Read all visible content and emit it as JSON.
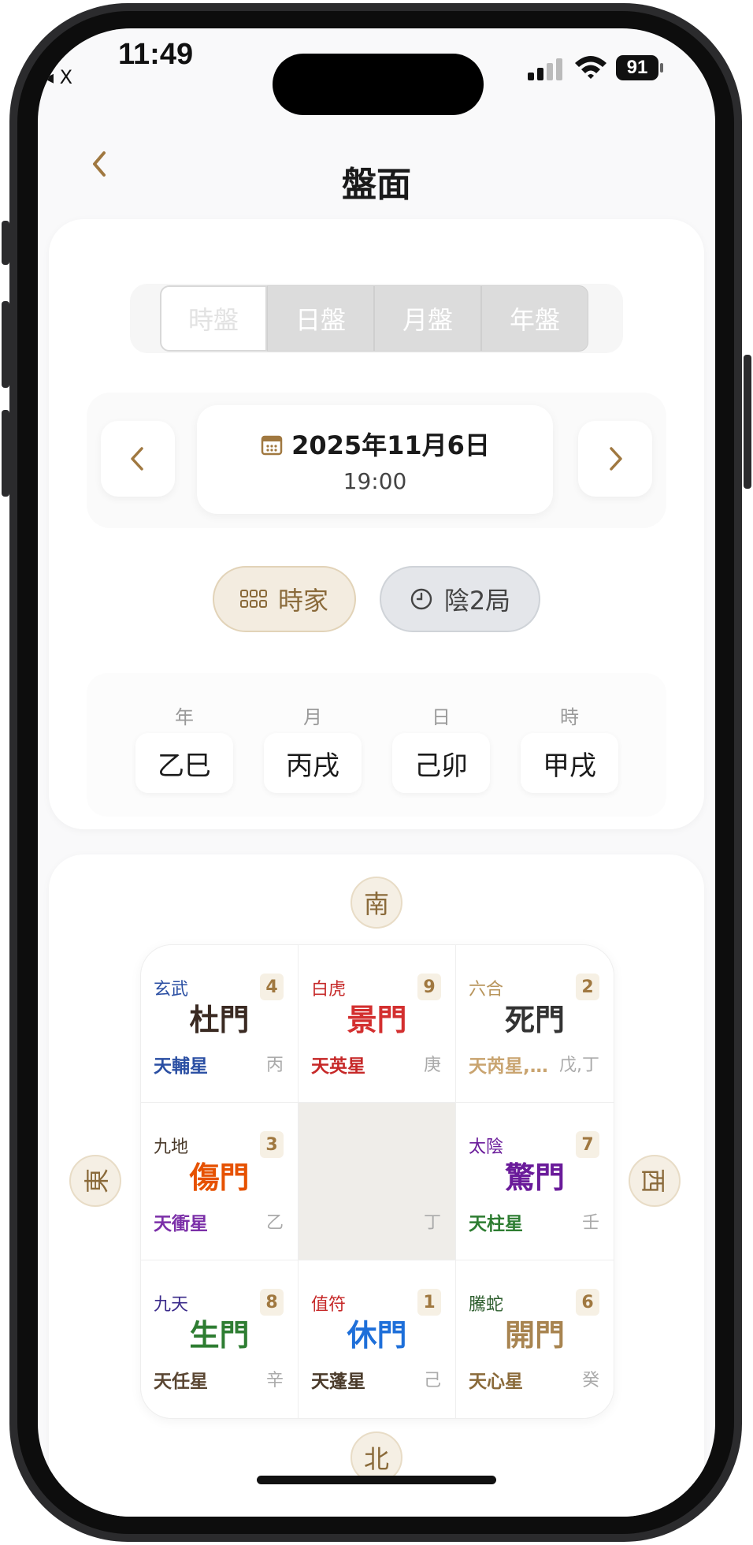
{
  "status_bar": {
    "time": "11:49",
    "back_app": "◂ X",
    "battery": "91"
  },
  "header": {
    "back_icon": "‹",
    "title": "盤面"
  },
  "tabs": [
    "時盤",
    "日盤",
    "月盤",
    "年盤"
  ],
  "date_nav": {
    "prev_icon": "‹",
    "next_icon": "›",
    "date": "2025年11月6日",
    "time": "19:00"
  },
  "pills": {
    "school": "時家",
    "ju": "陰2局"
  },
  "pillars": {
    "labels": [
      "年",
      "月",
      "日",
      "時"
    ],
    "values": [
      "乙巳",
      "丙戌",
      "己卯",
      "甲戌"
    ]
  },
  "compass": {
    "south": "南",
    "east": "東",
    "west": "西",
    "north": "北"
  },
  "palaces": [
    {
      "god": "玄武",
      "god_color": "#2b4fa3",
      "num": "4",
      "door": "杜門",
      "door_color": "#3a2a22",
      "star": "天輔星",
      "star_color": "#2b4fa3",
      "stem": "丙"
    },
    {
      "god": "白虎",
      "god_color": "#c62828",
      "num": "9",
      "door": "景門",
      "door_color": "#d32f2f",
      "star": "天英星",
      "star_color": "#c62828",
      "stem": "庚"
    },
    {
      "god": "六合",
      "god_color": "#b8955c",
      "num": "2",
      "door": "死門",
      "door_color": "#333333",
      "star": "天芮星,…",
      "star_color": "#c9a470",
      "stem": "戊,丁"
    },
    {
      "god": "九地",
      "god_color": "#4a3a2a",
      "num": "3",
      "door": "傷門",
      "door_color": "#e65100",
      "star": "天衝星",
      "star_color": "#7b2fa8",
      "stem": "乙"
    },
    {
      "center": true,
      "stem": "丁"
    },
    {
      "god": "太陰",
      "god_color": "#6a1b9a",
      "num": "7",
      "door": "驚門",
      "door_color": "#6a1b9a",
      "star": "天柱星",
      "star_color": "#2e7d32",
      "stem": "壬"
    },
    {
      "god": "九天",
      "god_color": "#3a2a8a",
      "num": "8",
      "door": "生門",
      "door_color": "#2e7d32",
      "star": "天任星",
      "star_color": "#5a4632",
      "stem": "辛"
    },
    {
      "god": "值符",
      "god_color": "#c62828",
      "num": "1",
      "door": "休門",
      "door_color": "#1e6fd9",
      "star": "天蓬星",
      "star_color": "#4a3a2a",
      "stem": "己"
    },
    {
      "god": "騰蛇",
      "god_color": "#2e5e2e",
      "num": "6",
      "door": "開門",
      "door_color": "#a88450",
      "star": "天心星",
      "star_color": "#8a6a3a",
      "stem": "癸"
    }
  ]
}
